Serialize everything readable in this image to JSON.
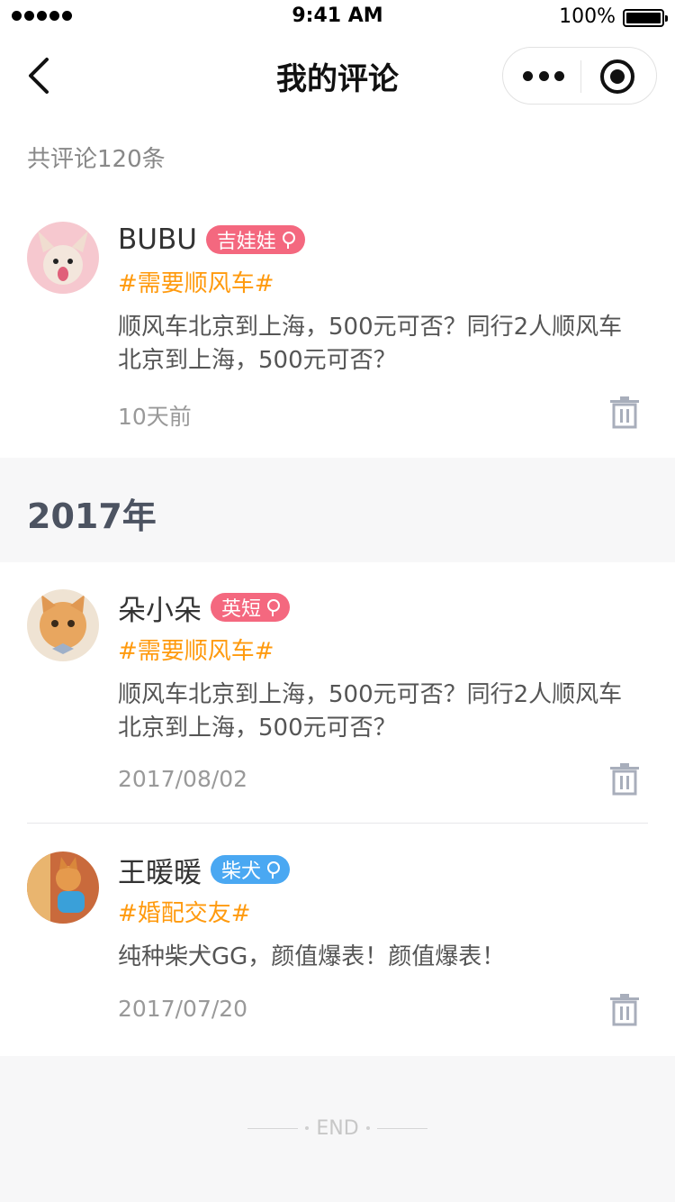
{
  "status_bar": {
    "time": "9:41 AM",
    "battery": "100%"
  },
  "nav": {
    "title": "我的评论",
    "back_icon": "chevron-left-icon",
    "more_icon": "more-dots-icon",
    "close_icon": "target-icon"
  },
  "summary": "共评论120条",
  "comments_recent": [
    {
      "name": "BUBU",
      "tag": "吉娃娃",
      "tag_color": "#f4687f",
      "gender": "female",
      "topic": "#需要顺风车#",
      "content": "顺风车北京到上海，500元可否？同行2人顺风车北京到上海，500元可否？",
      "date": "10天前"
    }
  ],
  "section": {
    "year": "2017年"
  },
  "comments_2017": [
    {
      "name": "朵小朵",
      "tag": "英短",
      "tag_color": "#f4687f",
      "gender": "female",
      "topic": "#需要顺风车#",
      "content": "顺风车北京到上海，500元可否？同行2人顺风车北京到上海，500元可否？",
      "date": "2017/08/02"
    },
    {
      "name": "王暖暖",
      "tag": "柴犬",
      "tag_color": "#4aa8f2",
      "gender": "female",
      "topic": "#婚配交友#",
      "content": "纯种柴犬GG，颜值爆表！颜值爆表！",
      "date": "2017/07/20"
    }
  ],
  "footer": {
    "end_text": "END"
  }
}
